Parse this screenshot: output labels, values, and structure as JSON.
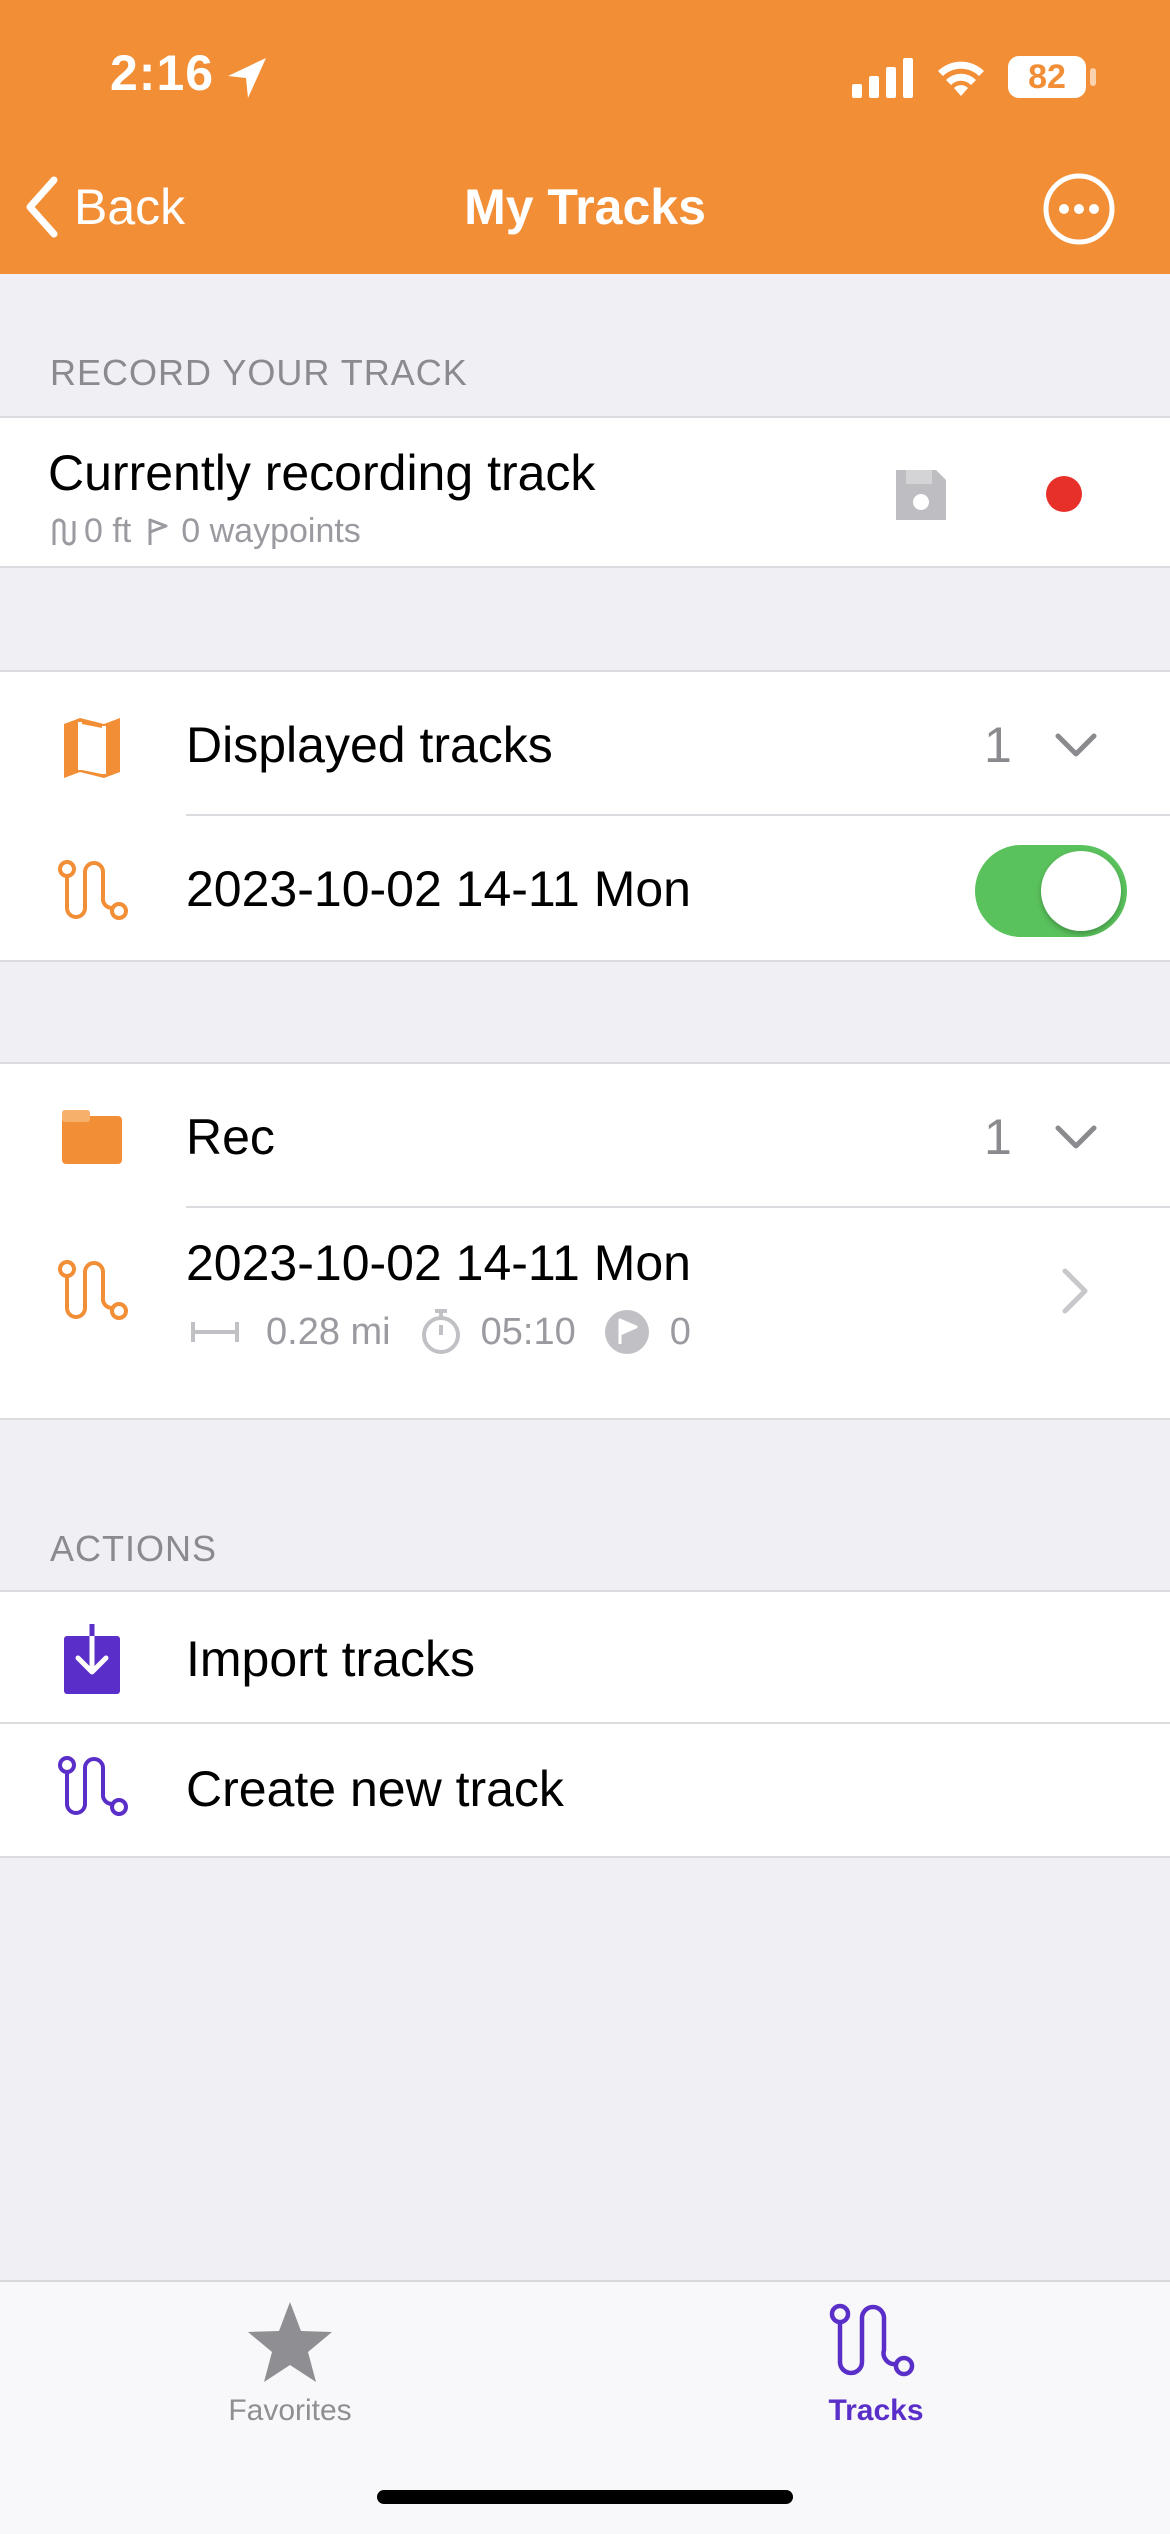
{
  "status_bar": {
    "time": "2:16",
    "battery": "82"
  },
  "nav": {
    "back_label": "Back",
    "title": "My Tracks"
  },
  "record_section": {
    "header": "RECORD YOUR TRACK",
    "title": "Currently recording track",
    "distance": "0 ft",
    "waypoints": "0 waypoints"
  },
  "displayed_tracks": {
    "title": "Displayed tracks",
    "count": "1",
    "track": {
      "name": "2023-10-02 14-11 Mon",
      "visible": true
    }
  },
  "rec_folder": {
    "title": "Rec",
    "count": "1",
    "track": {
      "name": "2023-10-02 14-11 Mon",
      "distance": "0.28 mi",
      "duration": "05:10",
      "waypoints": "0"
    }
  },
  "actions": {
    "header": "ACTIONS",
    "items": [
      {
        "label": "Import tracks",
        "icon": "import-icon"
      },
      {
        "label": "Create new track",
        "icon": "route-icon"
      }
    ]
  },
  "tabbar": {
    "tabs": [
      {
        "label": "Favorites",
        "icon": "star-icon",
        "active": false
      },
      {
        "label": "Tracks",
        "icon": "route-icon",
        "active": true
      }
    ]
  },
  "colors": {
    "accent": "#f28e36",
    "purple": "#5a2ec8",
    "toggle_on": "#5ac25c",
    "record_red": "#e8302a"
  }
}
